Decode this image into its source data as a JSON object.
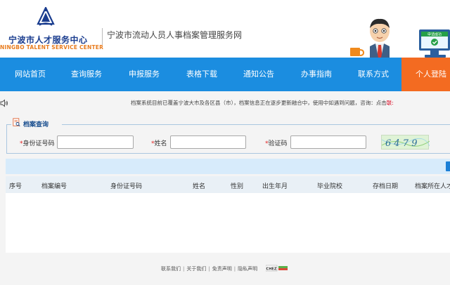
{
  "header": {
    "logo_cn": "宁波市人才服务中心",
    "logo_en": "NINGBO TALENT SERVICE CENTER",
    "site_title": "宁波市流动人员人事档案管理服务网",
    "monitor_text": "申请成功"
  },
  "nav": {
    "items": [
      {
        "label": "网站首页"
      },
      {
        "label": "查询服务"
      },
      {
        "label": "申报服务"
      },
      {
        "label": "表格下载"
      },
      {
        "label": "通知公告"
      },
      {
        "label": "办事指南"
      },
      {
        "label": "联系方式"
      },
      {
        "label": "个人登陆"
      }
    ]
  },
  "notice": {
    "text": "档案系统目前已覆盖宁波大市及各区县（市），档案信息正在逐步更新融合中，使用中如遇到问题，咨询：点击",
    "link": "联:"
  },
  "query": {
    "legend": "档案查询",
    "required_mark": "*",
    "id_label": "身份证号码",
    "name_label": "姓名",
    "captcha_label": "验证码",
    "id_value": "",
    "name_value": "",
    "captcha_value": "",
    "captcha_text": "6 4 7 9"
  },
  "table": {
    "columns": [
      "序号",
      "档案编号",
      "身份证号码",
      "姓名",
      "性别",
      "出生年月",
      "毕业院校",
      "存档日期",
      "档案所在人才"
    ],
    "rows": []
  },
  "footer": {
    "links": [
      "联系我们",
      "关于我们",
      "免责声明",
      "隐私声明"
    ],
    "separator": "|",
    "badge": "CHEZ"
  },
  "colors": {
    "nav_bg": "#1b8de0",
    "nav_active": "#f36b21",
    "brand_blue": "#1a3d8f",
    "brand_orange": "#e87c1e"
  }
}
